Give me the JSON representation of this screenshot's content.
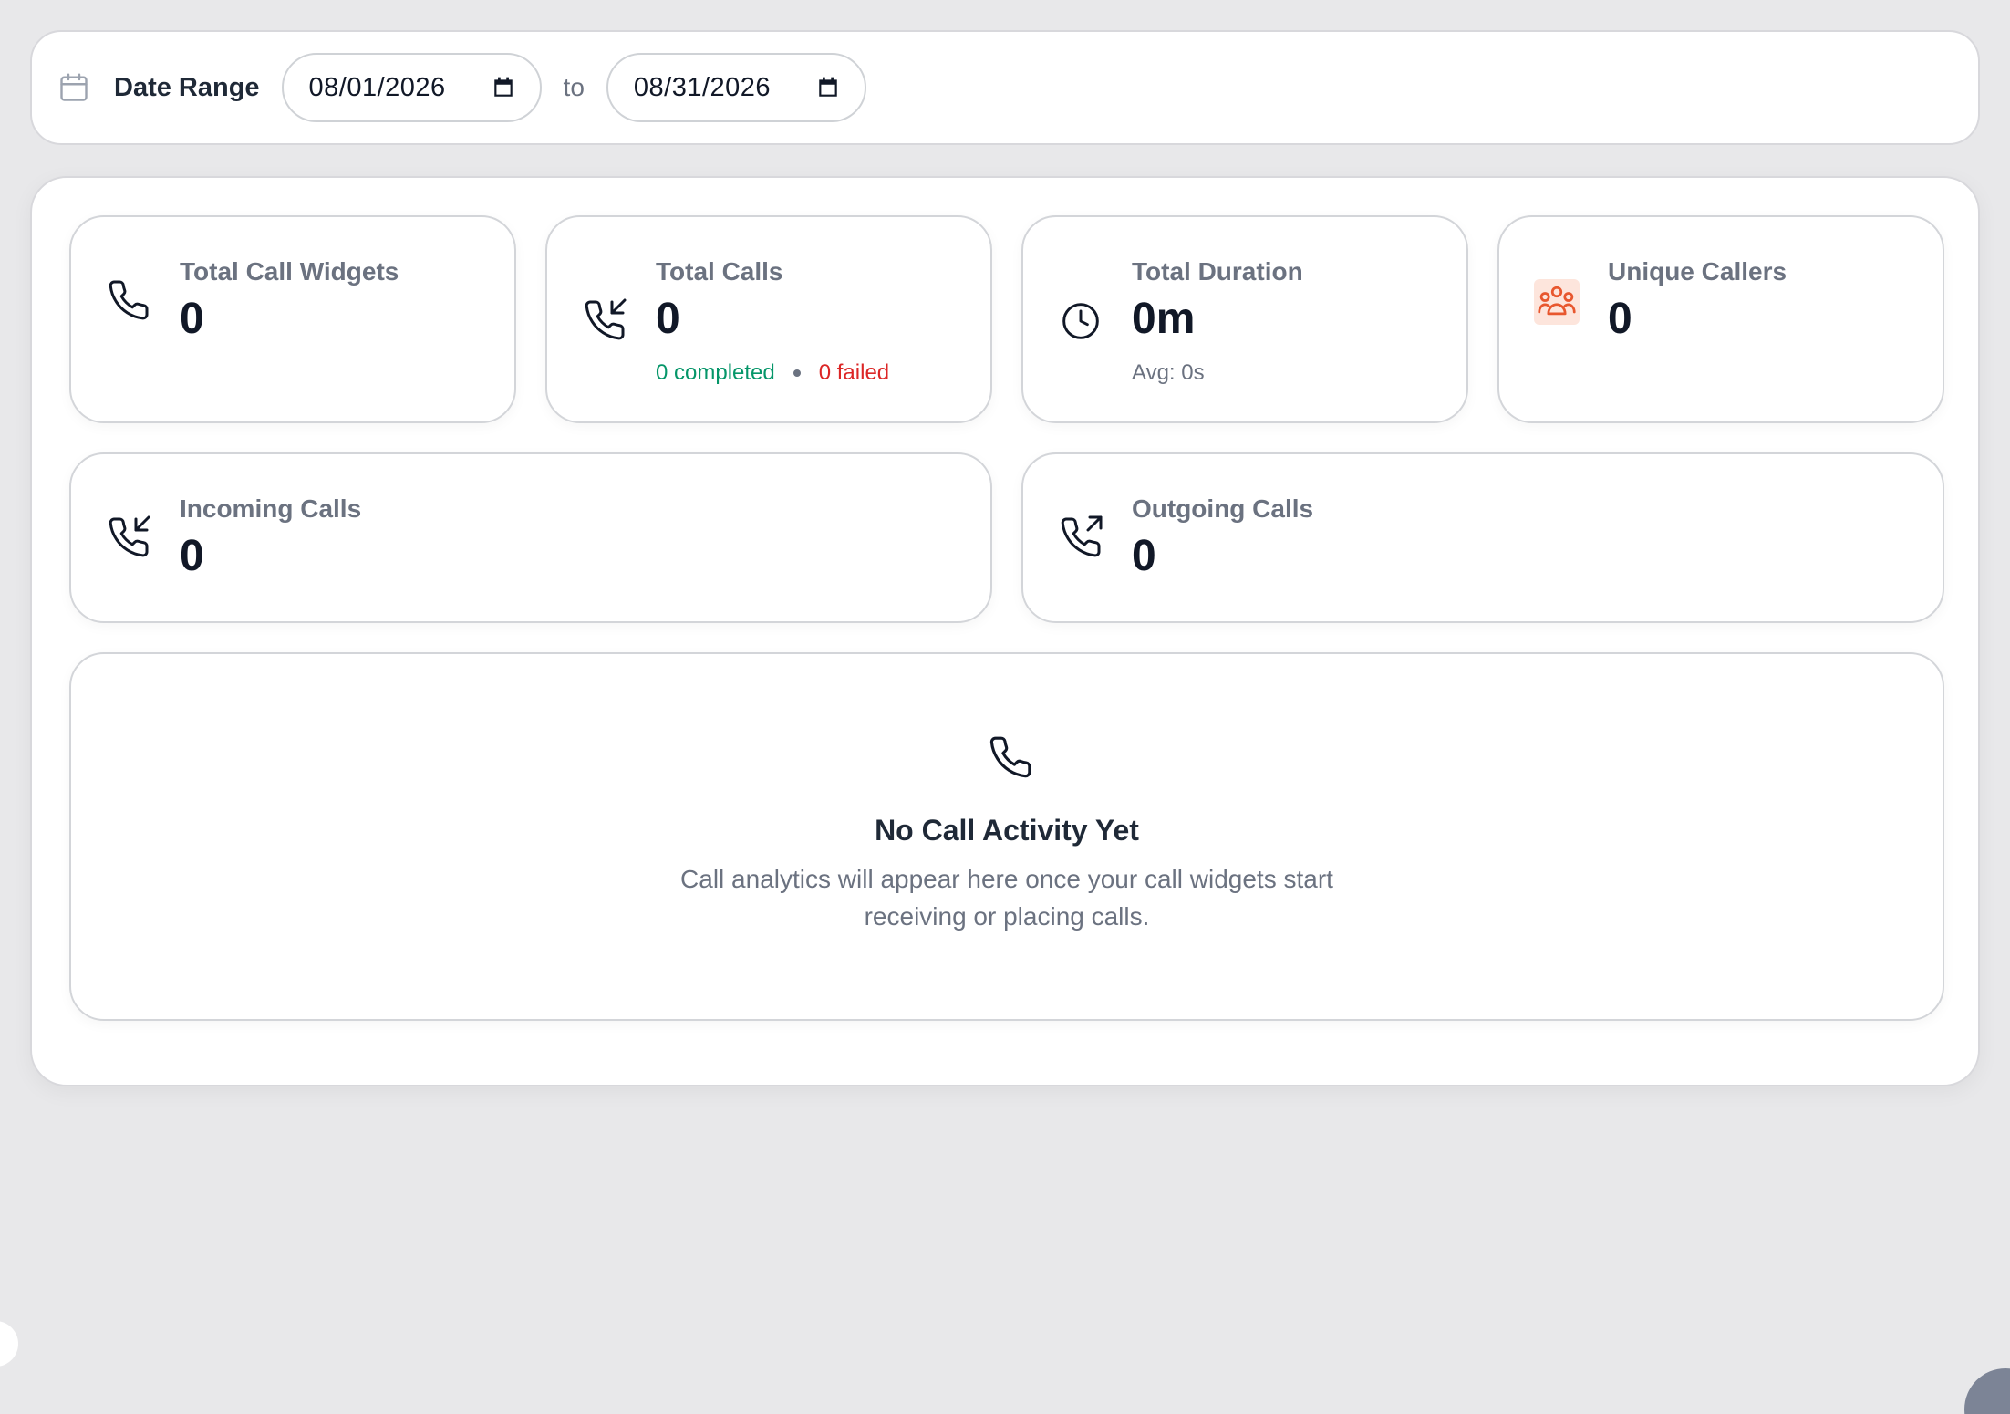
{
  "date_range": {
    "label": "Date Range",
    "start_date": "08/01/2026",
    "separator": "to",
    "end_date": "08/31/2026"
  },
  "stats": {
    "total_call_widgets": {
      "label": "Total Call Widgets",
      "value": "0"
    },
    "total_calls": {
      "label": "Total Calls",
      "value": "0",
      "completed": "0 completed",
      "failed": "0 failed"
    },
    "total_duration": {
      "label": "Total Duration",
      "value": "0m",
      "avg": "Avg: 0s"
    },
    "unique_callers": {
      "label": "Unique Callers",
      "value": "0"
    },
    "incoming_calls": {
      "label": "Incoming Calls",
      "value": "0"
    },
    "outgoing_calls": {
      "label": "Outgoing Calls",
      "value": "0"
    }
  },
  "empty_state": {
    "title": "No Call Activity Yet",
    "description_line1": "Call analytics will appear here once your call widgets start",
    "description_line2": "receiving or placing calls."
  },
  "colors": {
    "completed": "#059669",
    "failed": "#dc2626",
    "accent_users": "#e8572e"
  },
  "icons": {
    "date_range": "calendar-icon",
    "widgets": "phone-icon",
    "calls": "phone-incoming-icon",
    "duration": "clock-icon",
    "callers": "users-icon",
    "incoming": "phone-incoming-icon",
    "outgoing": "phone-outgoing-icon",
    "empty": "phone-icon"
  }
}
